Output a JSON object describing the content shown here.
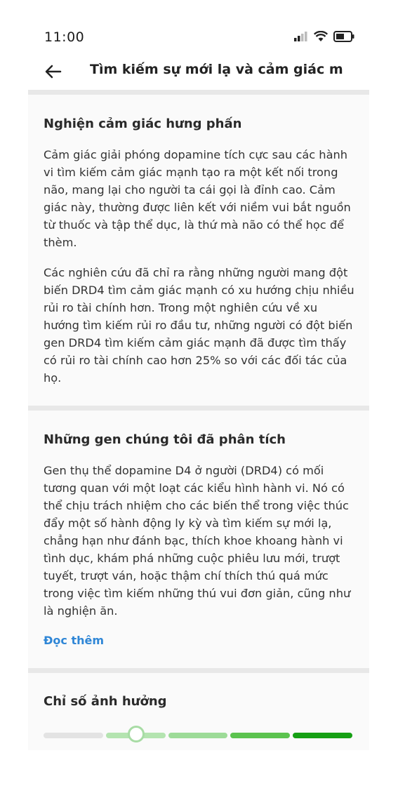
{
  "status": {
    "time": "11:00"
  },
  "header": {
    "title": "Tìm kiếm sự mới lạ và cảm giác mạnh"
  },
  "section1": {
    "heading": "Nghiện cảm giác hưng phấn",
    "para1": "Cảm giác giải phóng dopamine tích cực sau các hành vi tìm kiếm cảm giác mạnh tạo ra một kết nối trong não, mang lại cho người ta cái gọi là đỉnh cao. Cảm giác này, thường được liên kết với niềm vui bắt nguồn từ thuốc và tập thể dục, là thứ mà não có thể học để thèm.",
    "para2": "Các nghiên cứu đã chỉ ra rằng những người mang đột biến DRD4 tìm cảm giác mạnh có xu hướng chịu nhiều rủi ro tài chính hơn. Trong một nghiên cứu về xu hướng tìm kiếm rủi ro đầu tư, những người có đột biến gen DRD4 tìm kiếm cảm giác mạnh đã được tìm thấy có rủi ro tài chính cao hơn 25% so với các đối tác của họ."
  },
  "section2": {
    "heading": "Những gen chúng tôi đã phân tích",
    "para": "Gen thụ thể dopamine D4 ở người (DRD4) có mối tương quan với một loạt các kiểu hình hành vi. Nó có thể chịu trách nhiệm cho các biến thể trong việc thúc đẩy một số hành động ly kỳ và tìm kiếm sự mới lạ, chẳng hạn như đánh bạc, thích khoe khoang hành vi tình dục, khám phá những cuộc phiêu lưu mới, trượt tuyết, trượt ván, hoặc thậm chí thích thú quá mức trong việc tìm kiếm những thú vui đơn giản, cũng như là nghiện ăn.",
    "read_more": "Đọc thêm"
  },
  "section3": {
    "heading": "Chỉ số ảnh hưởng",
    "scale_colors": [
      "#e3e3e3",
      "#b4e4b0",
      "#9ddb98",
      "#5cc34f",
      "#16a014"
    ],
    "indicator_position": 0.3
  }
}
